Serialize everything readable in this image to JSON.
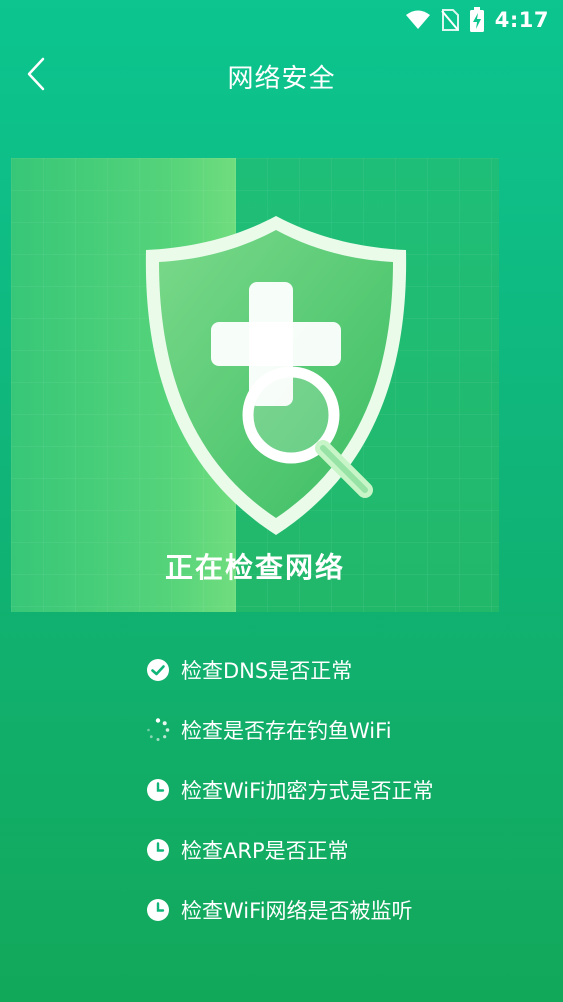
{
  "status_bar": {
    "time": "4:17",
    "icons": [
      "wifi-icon",
      "no-sim-icon",
      "battery-charging-icon"
    ]
  },
  "header": {
    "title": "网络安全",
    "back_icon": "back-chevron-icon"
  },
  "hero": {
    "icon": "shield-search-icon",
    "label": "正在检查网络"
  },
  "checks": [
    {
      "label": "检查DNS是否正常",
      "status": "done",
      "icon": "check-circle-icon"
    },
    {
      "label": "检查是否存在钓鱼WiFi",
      "status": "in-progress",
      "icon": "loading-spinner-icon"
    },
    {
      "label": "检查WiFi加密方式是否正常",
      "status": "pending",
      "icon": "clock-icon"
    },
    {
      "label": "检查ARP是否正常",
      "status": "pending",
      "icon": "clock-icon"
    },
    {
      "label": "检查WiFi网络是否被监听",
      "status": "pending",
      "icon": "clock-icon"
    }
  ],
  "colors": {
    "bg_top": "#0cc58f",
    "bg_bottom": "#12a85a",
    "text": "#ffffff"
  }
}
